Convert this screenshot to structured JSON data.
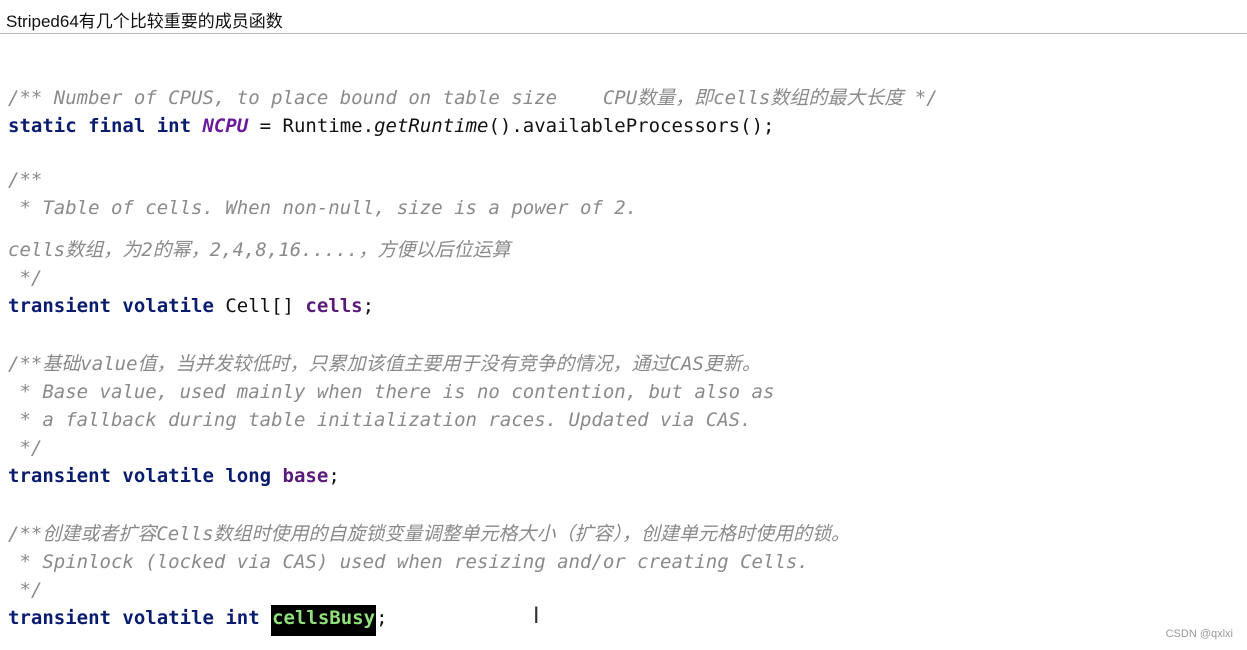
{
  "title": "Striped64有几个比较重要的成员函数",
  "code": {
    "ncpu_comment": "/** Number of CPUS, to place bound on table size    CPU数量，即cells数组的最大长度 */",
    "ncpu_decl": {
      "kw": "static final int ",
      "name": "NCPU",
      "eq": " = Runtime.",
      "method": "getRuntime",
      "rest": "().availableProcessors();"
    },
    "cells_comment": [
      "/**",
      " * Table of cells. When non-null, size is a power of 2.",
      "cells数组，为2的幂，2,4,8,16.....，方便以后位运算",
      " */"
    ],
    "cells_decl": {
      "kw": "transient volatile ",
      "type": "Cell[] ",
      "name": "cells",
      "end": ";"
    },
    "base_comment": [
      "/**基础value值，当并发较低时，只累加该值主要用于没有竞争的情况，通过CAS更新。",
      " * Base value, used mainly when there is no contention, but also as",
      " * a fallback during table initialization races. Updated via CAS.",
      " */"
    ],
    "base_decl": {
      "kw": "transient volatile long ",
      "name": "base",
      "end": ";"
    },
    "busy_comment": [
      "/**创建或者扩容Cells数组时使用的自旋锁变量调整单元格大小（扩容），创建单元格时使用的锁。",
      " * Spinlock (locked via CAS) used when resizing and/or creating Cells.",
      " */"
    ],
    "busy_decl": {
      "kw": "transient volatile int ",
      "name": "cellsBusy",
      "end": ";"
    }
  },
  "cursor_glyph": "I",
  "watermark": "CSDN @qxlxi"
}
